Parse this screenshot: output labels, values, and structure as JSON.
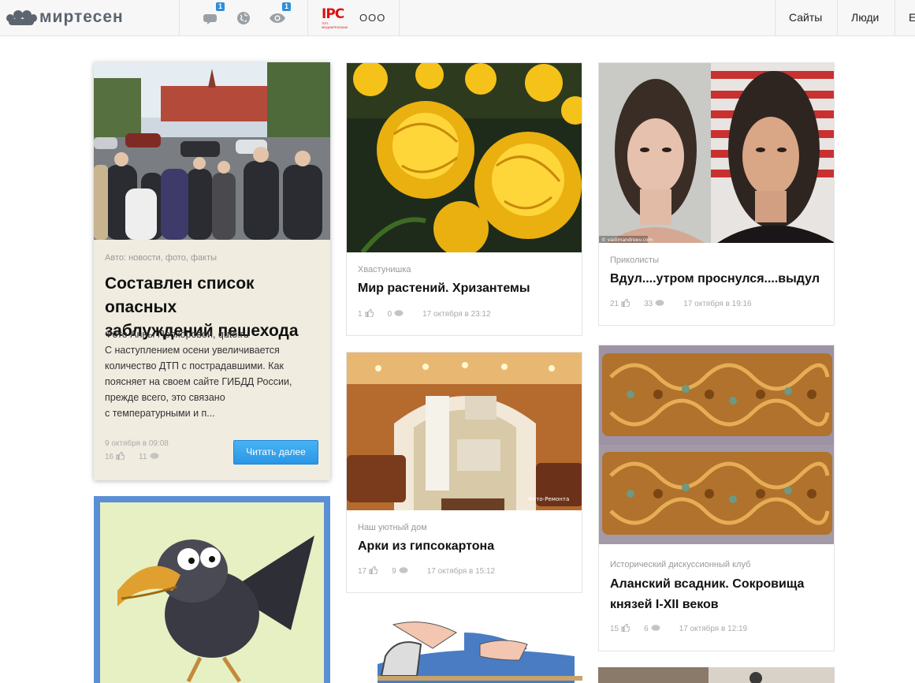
{
  "header": {
    "logo_text": "миртесен",
    "messages_badge": "1",
    "views_badge": "1",
    "ipc_logo": "IPC",
    "ipc_sub": "ТОП-МЕДИАРЕКЛАМА",
    "company": "ООО",
    "nav": [
      "Сайты",
      "Люди",
      "Е"
    ]
  },
  "cards": [
    {
      "category": "Авто: новости, фото, факты",
      "title_line1": "Составлен список опасных",
      "title_line2": "заблуждений пешехода",
      "excerpt": [
        "Фото Анны Прохоровой, quto.ru",
        "С наступлением осени увеличивается",
        "количество ДТП с пострадавшими. Как",
        "поясняет на своем сайте ГИБДД России,",
        "прежде всего, это связано",
        "с температурными и п..."
      ],
      "date": "9 октября в 09:08",
      "likes": "16",
      "comments": "11",
      "read_more": "Читать далее"
    },
    {
      "category": "Хвастунишка",
      "title": "Мир растений. Хризантемы",
      "likes": "1",
      "comments": "0",
      "date": "17 октября в 23:12"
    },
    {
      "category": "Приколисты",
      "title": "Вдул....утром проснулся....выдул",
      "likes": "21",
      "comments": "33",
      "date": "17 октября в 19:16",
      "watermark": "© vadimandreev.com"
    },
    {
      "category": "Наш уютный дом",
      "title": "Арки из гипсокартона",
      "likes": "17",
      "comments": "9",
      "date": "17 октября в 15:12",
      "watermark": "Фото-Ремонта"
    },
    {
      "category": "Исторический дискуссионный клуб",
      "title_line1": "Аланский всадник. Сокровища",
      "title_line2": "князей I-XII веков",
      "likes": "15",
      "comments": "6",
      "date": "17 октября в 12:19"
    }
  ]
}
